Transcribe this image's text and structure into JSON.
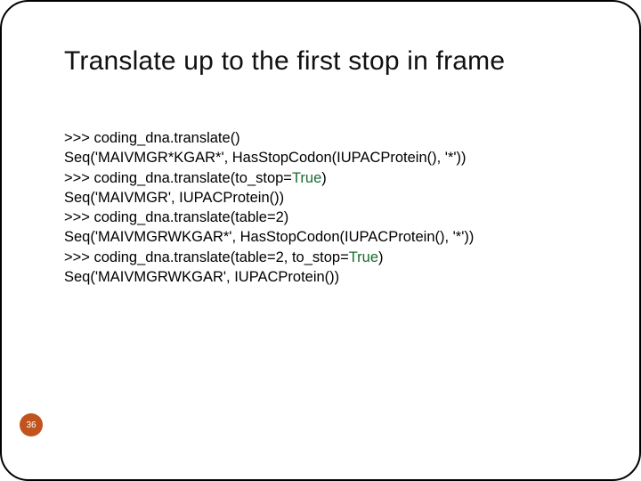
{
  "title": "Translate up to the first stop in frame",
  "code": {
    "l1a": ">>> coding_dna.translate()",
    "l2a": "Seq('MAIVMGR*KGAR*', HasStopCodon(IUPACProtein(), '*'))",
    "l3a": ">>> coding_dna.translate(to_stop=",
    "l3b": "True",
    "l3c": ")",
    "l4a": "Seq('MAIVMGR', IUPACProtein())",
    "l5a": ">>> coding_dna.translate(table=2)",
    "l6a": "Seq('MAIVMGRWKGAR*', HasStopCodon(IUPACProtein(), '*'))",
    "l7a": ">>> coding_dna.translate(table=2, to_stop=",
    "l7b": "True",
    "l7c": ")",
    "l8a": "Seq('MAIVMGRWKGAR', IUPACProtein())"
  },
  "page_number": "36"
}
